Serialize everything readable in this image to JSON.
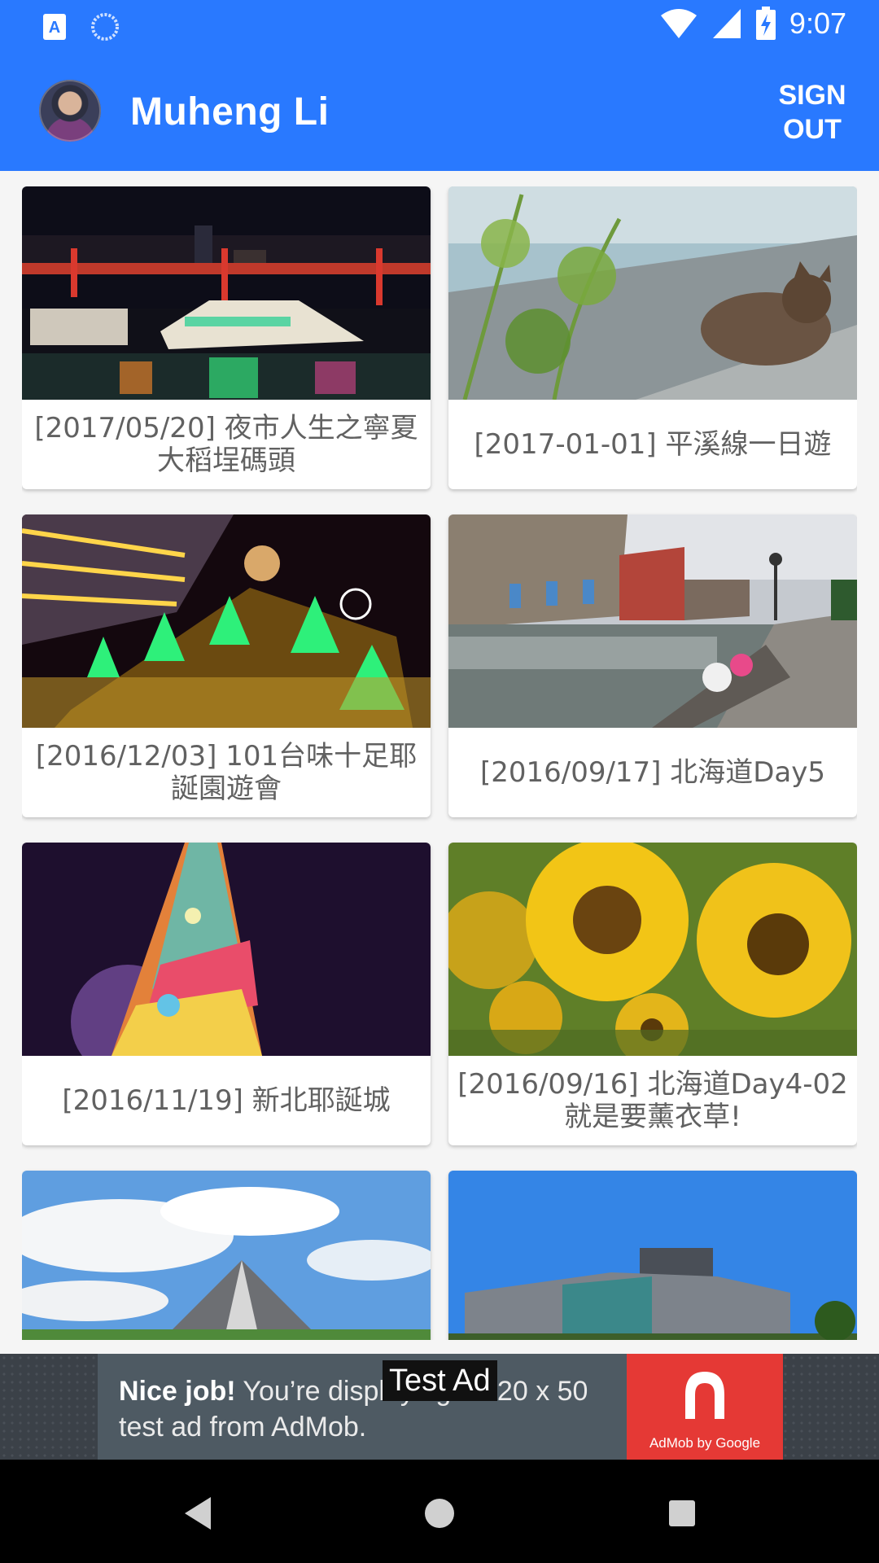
{
  "status_bar": {
    "time": "9:07",
    "left_icons": [
      "app-a-icon",
      "sync-icon"
    ],
    "right_icons": [
      "wifi-icon",
      "signal-icon",
      "battery-charging-icon"
    ]
  },
  "app_bar": {
    "user_name": "Muheng Li",
    "sign_out_label": "SIGN\nOUT",
    "color": "#2979ff"
  },
  "albums": [
    {
      "title": "[2017/05/20] 夜市人生之寧夏大稻埕碼頭",
      "photo": "night harbor boats"
    },
    {
      "title": "[2017-01-01] 平溪線一日遊",
      "photo": "sleeping cat"
    },
    {
      "title": "[2016/12/03] 101台味十足耶誕園遊會",
      "photo": "christmas lights"
    },
    {
      "title": "[2016/09/17] 北海道Day5",
      "photo": "otaru canal"
    },
    {
      "title": "[2016/11/19] 新北耶誕城",
      "photo": "light tower"
    },
    {
      "title": "[2016/09/16] 北海道Day4-02 就是要薰衣草!",
      "photo": "sunflowers"
    },
    {
      "title": "",
      "photo": "pyramid sky"
    },
    {
      "title": "",
      "photo": "modern building"
    }
  ],
  "ad": {
    "badge": "Test Ad",
    "headline": "Nice job!",
    "body": " You’re displaying a 320 x 50 test ad from AdMob.",
    "brand": "AdMob by Google"
  },
  "nav_icons": [
    "back-icon",
    "home-icon",
    "recents-icon"
  ]
}
